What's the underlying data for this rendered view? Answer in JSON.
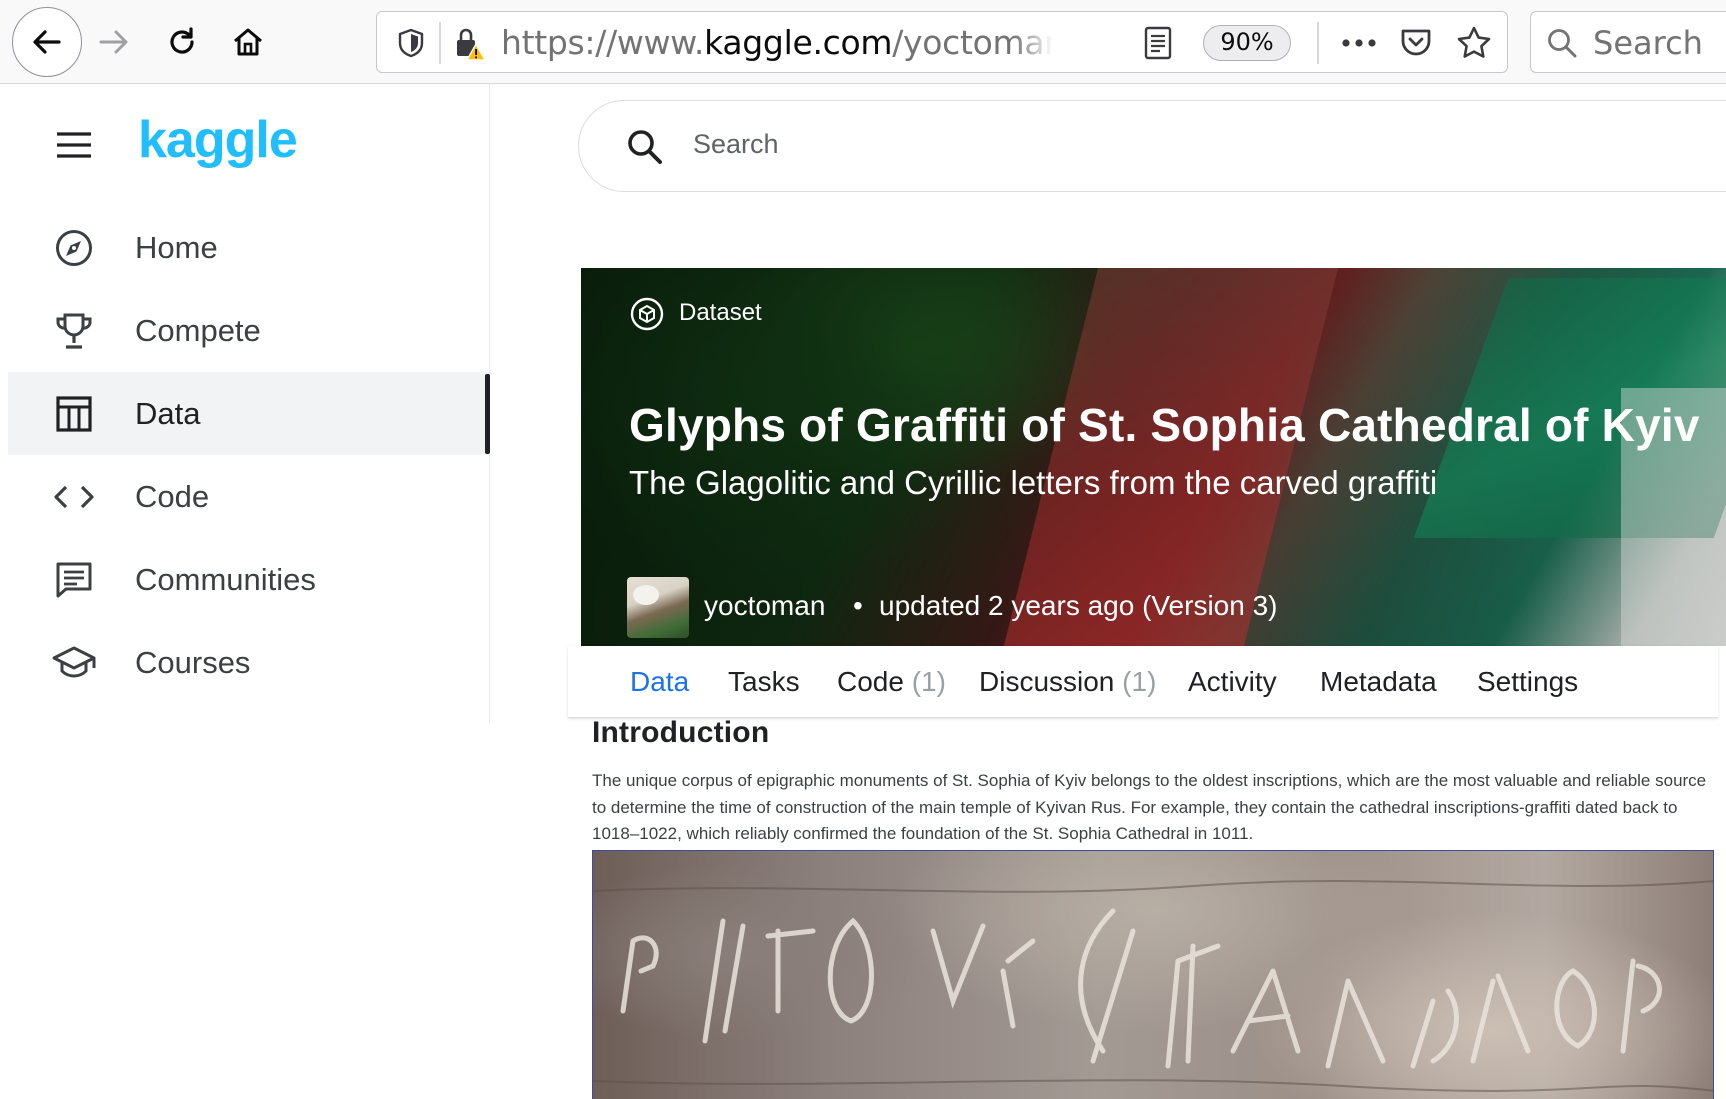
{
  "browser": {
    "url_prefix": "https://www.",
    "url_domain": "kaggle.com",
    "url_path": "/yoctoman/graffiti",
    "zoom": "90%",
    "search_placeholder": "Search"
  },
  "sidebar": {
    "logo": "kaggle",
    "items": [
      {
        "label": "Home",
        "icon": "compass-icon"
      },
      {
        "label": "Compete",
        "icon": "trophy-icon"
      },
      {
        "label": "Data",
        "icon": "table-icon",
        "active": true
      },
      {
        "label": "Code",
        "icon": "code-icon"
      },
      {
        "label": "Communities",
        "icon": "comments-icon"
      },
      {
        "label": "Courses",
        "icon": "graduation-cap-icon"
      }
    ]
  },
  "site_search": {
    "placeholder": "Search"
  },
  "dataset": {
    "type_label": "Dataset",
    "title": "Glyphs of Graffiti of St. Sophia Cathedral of Kyiv",
    "subtitle": "The Glagolitic and Cyrillic letters from the carved graffiti",
    "author": "yoctoman",
    "bullet": "•",
    "updated": "updated 2 years ago (Version 3)"
  },
  "tabs": [
    {
      "label": "Data",
      "count": "",
      "active": true
    },
    {
      "label": "Tasks",
      "count": ""
    },
    {
      "label": "Code",
      "count": "(1)"
    },
    {
      "label": "Discussion",
      "count": "(1)"
    },
    {
      "label": "Activity",
      "count": ""
    },
    {
      "label": "Metadata",
      "count": ""
    },
    {
      "label": "Settings",
      "count": ""
    }
  ],
  "intro": {
    "heading": "Introduction",
    "paragraph": "The unique corpus of epigraphic monuments of St. Sophia of Kyiv belongs to the oldest inscriptions, which are the most valuable and reliable source to determine the time of construction of the main temple of Kyivan Rus. For example, they contain the cathedral inscriptions-graffiti dated back to 1018–1022, which reliably confirmed the foundation of the St. Sophia Cathedral in 1011."
  },
  "colors": {
    "kaggle_blue": "#20beff",
    "active_tab": "#1a73e8"
  }
}
